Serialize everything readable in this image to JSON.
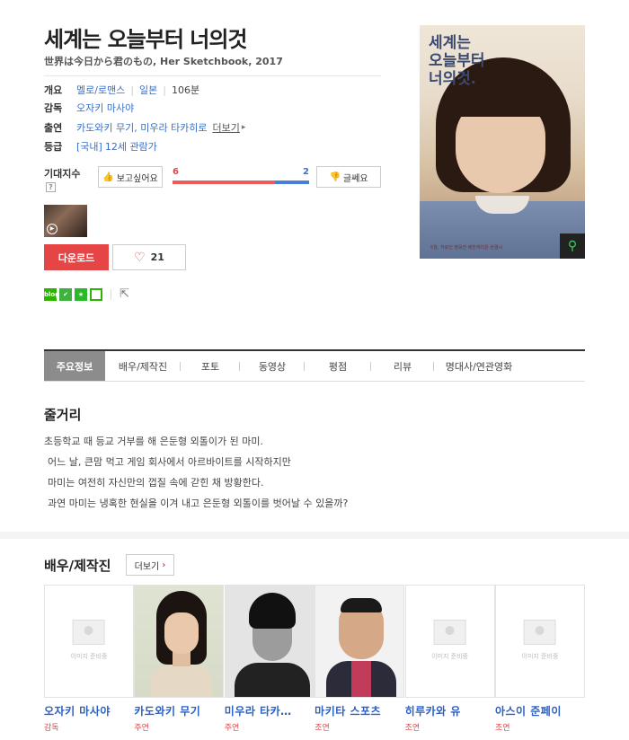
{
  "movie": {
    "title": "세계는 오늘부터 너의것",
    "subtitle": "世界は今日から君のもの, Her Sketchbook, 2017"
  },
  "info": {
    "overview_label": "개요",
    "genre": "멜로/로맨스",
    "country": "일본",
    "runtime": "106분",
    "director_label": "감독",
    "director": "오자키 마사야",
    "cast_label": "출연",
    "cast_names": "카도와키 무기, 미우라 타카히로",
    "more_label": "더보기",
    "rating_label": "등급",
    "rating_prefix": "[국내]",
    "rating": "12세 관람가"
  },
  "expectation": {
    "label": "기대지수",
    "help": "?",
    "want_label": "보고싶어요",
    "want_count": "6",
    "meh_count": "2",
    "meh_label": "글쎄요",
    "want_fraction": 0.75
  },
  "actions": {
    "download_label": "다운로드",
    "like_count": "21"
  },
  "poster": {
    "title_lines": [
      "세계는",
      "오늘부터",
      "너의것."
    ],
    "tagline": "5월, 히로인 영웅전 에반게리온 완결시"
  },
  "tabs": [
    "주요정보",
    "배우/제작진",
    "포토",
    "동영상",
    "평점",
    "리뷰",
    "명대사/연관영화"
  ],
  "synopsis": {
    "heading": "줄거리",
    "lines": [
      "초등학교 때 등교 거부를 해 은둔형 외톨이가 된 마미.",
      "어느 날, 큰맘 먹고 게임 회사에서 아르바이트를 시작하지만",
      "마미는 여전히 자신만의 껍질 속에 갇힌 채 방황한다.",
      "과연 마미는 냉혹한 현실을 이겨 내고 은둔형 외톨이를 벗어날 수 있을까?"
    ]
  },
  "cast_section": {
    "heading": "배우/제작진",
    "more_label": "더보기",
    "no_image_text": "이미지 준비중",
    "people": [
      {
        "name": "오자키 마사야",
        "role": "감독",
        "photo": "none"
      },
      {
        "name": "카도와키 무기",
        "role": "주연",
        "photo": "woman"
      },
      {
        "name": "미우라 타카…",
        "role": "주연",
        "photo": "man1"
      },
      {
        "name": "마키타 스포츠",
        "role": "조연",
        "photo": "man2"
      },
      {
        "name": "히루카와 유",
        "role": "조연",
        "photo": "none"
      },
      {
        "name": "아스이 준페이",
        "role": "조연",
        "photo": "none"
      }
    ]
  },
  "colors": {
    "accent_red": "#e64545",
    "link_blue": "#3a6fc7",
    "tab_active": "#8c8c8c",
    "naver_green": "#2db400"
  }
}
